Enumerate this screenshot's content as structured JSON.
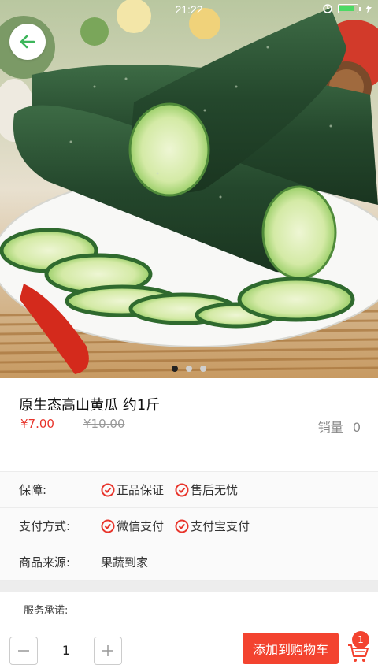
{
  "status_bar": {
    "time": "21:22"
  },
  "carousel": {
    "slide_count": 3,
    "active_index": 0
  },
  "product": {
    "title": "原生态高山黄瓜 约1斤",
    "price": "¥7.00",
    "original_price": "¥10.00",
    "sales_label": "销量",
    "sales_value": "0"
  },
  "attributes": [
    {
      "label": "保障:",
      "values": [
        "正品保证",
        "售后无忧"
      ],
      "has_check": true
    },
    {
      "label": "支付方式:",
      "values": [
        "微信支付",
        "支付宝支付"
      ],
      "has_check": true
    },
    {
      "label": "商品来源:",
      "values": [
        "果蔬到家"
      ],
      "has_check": false
    }
  ],
  "service_promise": {
    "label": "服务承诺:"
  },
  "bottom_bar": {
    "quantity": "1",
    "add_to_cart_label": "添加到购物车",
    "cart_count": "1"
  },
  "colors": {
    "accent_red": "#f3432f",
    "price_red": "#e8342b",
    "back_arrow_green": "#3cb55a"
  }
}
